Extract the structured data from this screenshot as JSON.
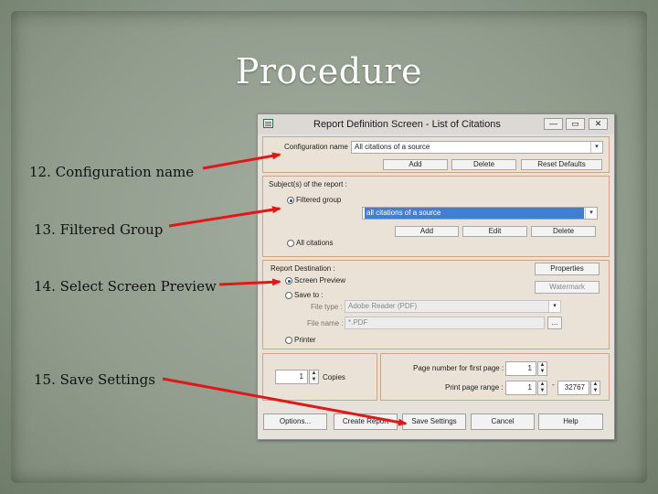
{
  "slide": {
    "title": "Procedure",
    "steps": [
      "12. Configuration name",
      "13. Filtered Group",
      "14.  Select Screen Preview",
      "15.  Save Settings"
    ]
  },
  "dialog": {
    "title": "Report Definition Screen - List of Citations",
    "window_buttons": [
      "—",
      "▭",
      "✕"
    ],
    "config": {
      "label": "Configuration name",
      "value": "All citations of a source",
      "buttons": [
        "Add",
        "Delete",
        "Reset Defaults"
      ]
    },
    "subjects": {
      "label": "Subject(s) of the report :",
      "filtered_label": "Filtered group",
      "filtered_selected": true,
      "group_value": "all citations of a source",
      "buttons": [
        "Add",
        "Edit",
        "Delete"
      ],
      "all_label": "All citations"
    },
    "destination": {
      "label": "Report Destination :",
      "screen_preview": "Screen Preview",
      "screen_preview_selected": true,
      "save_to": "Save to :",
      "file_type_label": "File type :",
      "file_type_value": "Adobe Reader (PDF)",
      "file_name_label": "File name :",
      "file_name_value": "*.PDF",
      "browse": "...",
      "printer": "Printer",
      "properties": "Properties",
      "watermark": "Watermark"
    },
    "copies": {
      "value": "1",
      "label": "Copies"
    },
    "pages": {
      "first_page_label": "Page number for first page :",
      "first_page_value": "1",
      "range_label": "Print page range :",
      "range_from": "1",
      "range_sep": "-",
      "range_to": "32767"
    },
    "footer_buttons": [
      "Options...",
      "Create Report",
      "Save Settings",
      "Cancel",
      "Help"
    ]
  },
  "icons": {
    "dropdown": "▾",
    "spin": [
      "▲",
      "▼"
    ]
  },
  "colors": {
    "arrow": "#e01818",
    "selection": "#3f7fd6",
    "panel_border": "#c9a58a"
  }
}
